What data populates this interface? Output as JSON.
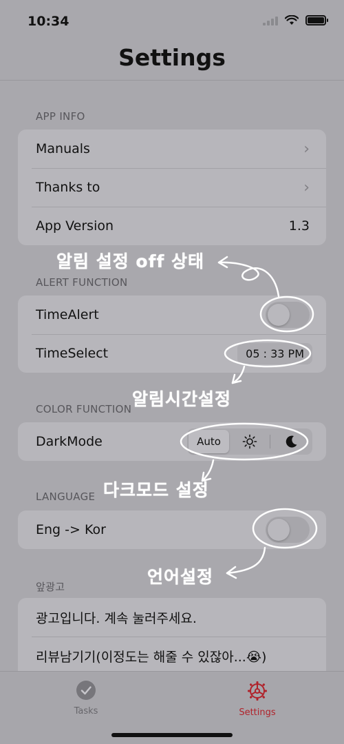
{
  "status_bar": {
    "time": "10:34"
  },
  "nav": {
    "title": "Settings"
  },
  "sections": {
    "app_info": {
      "header": "APP INFO",
      "rows": [
        {
          "label": "Manuals"
        },
        {
          "label": "Thanks to"
        },
        {
          "label": "App Version",
          "value": "1.3"
        }
      ]
    },
    "alert_function": {
      "header": "ALERT FUNCTION",
      "rows": [
        {
          "label": "TimeAlert",
          "toggle_on": false
        },
        {
          "label": "TimeSelect",
          "value": "05 : 33 PM"
        }
      ]
    },
    "color_function": {
      "header": "COLOR FUNCTION",
      "rows": [
        {
          "label": "DarkMode",
          "options": [
            "Auto",
            "light",
            "dark"
          ],
          "selected": "Auto"
        }
      ]
    },
    "language": {
      "header": "LANGUAGE",
      "rows": [
        {
          "label": "Eng -> Kor",
          "toggle_on": false
        }
      ]
    },
    "ads": {
      "header": "앞광고",
      "rows": [
        {
          "label": "광고입니다. 계속 눌러주세요."
        },
        {
          "label": "리뷰남기기(이정도는 해줄 수 있잖아...😭)"
        }
      ]
    }
  },
  "annotations": {
    "alert_off": "알림 설정 off 상태",
    "alert_time": "알림시간설정",
    "dark_mode": "다크모드 설정",
    "language": "언어설정"
  },
  "tab_bar": {
    "tasks_label": "Tasks",
    "settings_label": "Settings",
    "active": "Settings"
  },
  "colors": {
    "background": "#a9a8ad",
    "accent_active_tab": "#b0232b",
    "annotation": "#ffffff"
  }
}
